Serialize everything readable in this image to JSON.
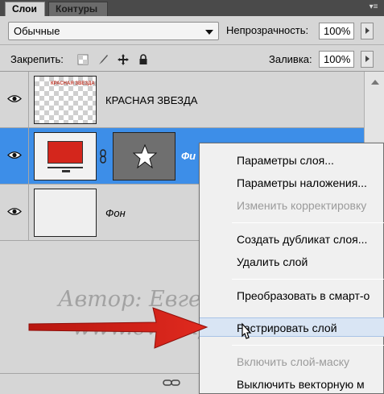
{
  "tabs": [
    {
      "label": "Слои",
      "active": true
    },
    {
      "label": "Контуры",
      "active": false
    }
  ],
  "toolbar": {
    "blend_mode": "Обычные",
    "opacity_label": "Непрозрачность:",
    "opacity_value": "100%",
    "lock_label": "Закрепить:",
    "fill_label": "Заливка:",
    "fill_value": "100%"
  },
  "layers": [
    {
      "name": "КРАСНАЯ ЗВЕЗДА",
      "visible": true,
      "selected": false,
      "thumb_text": "КРАСНАЯ ЗВЕЗДА"
    },
    {
      "name": "Фи",
      "visible": true,
      "selected": true
    },
    {
      "name": "Фон",
      "visible": true,
      "selected": false
    }
  ],
  "context_menu": {
    "items": [
      {
        "label": "Параметры слоя...",
        "disabled": false
      },
      {
        "label": "Параметры наложения...",
        "disabled": false
      },
      {
        "label": "Изменить корректировку",
        "disabled": true
      },
      {
        "label": "Создать дубликат слоя...",
        "disabled": false
      },
      {
        "label": "Удалить слой",
        "disabled": false
      },
      {
        "label": "Преобразовать в смарт-о",
        "disabled": false
      },
      {
        "label": "Растрировать слой",
        "disabled": false,
        "hover": true
      },
      {
        "label": "Включить слой-маску",
        "disabled": true
      },
      {
        "label": "Выключить векторную м",
        "disabled": false
      }
    ]
  },
  "watermark": {
    "author": "Автор:  Евгений  Попов",
    "site": "www.evgenypopov.com"
  },
  "colors": {
    "selection": "#3d8ee8",
    "layer_red": "#d4261c",
    "arrow": "#d8231a"
  },
  "icons": [
    "eye-icon",
    "link-chain-icon",
    "star-icon",
    "lock-icon",
    "move-icon",
    "brush-icon",
    "pointer-cursor-icon"
  ]
}
